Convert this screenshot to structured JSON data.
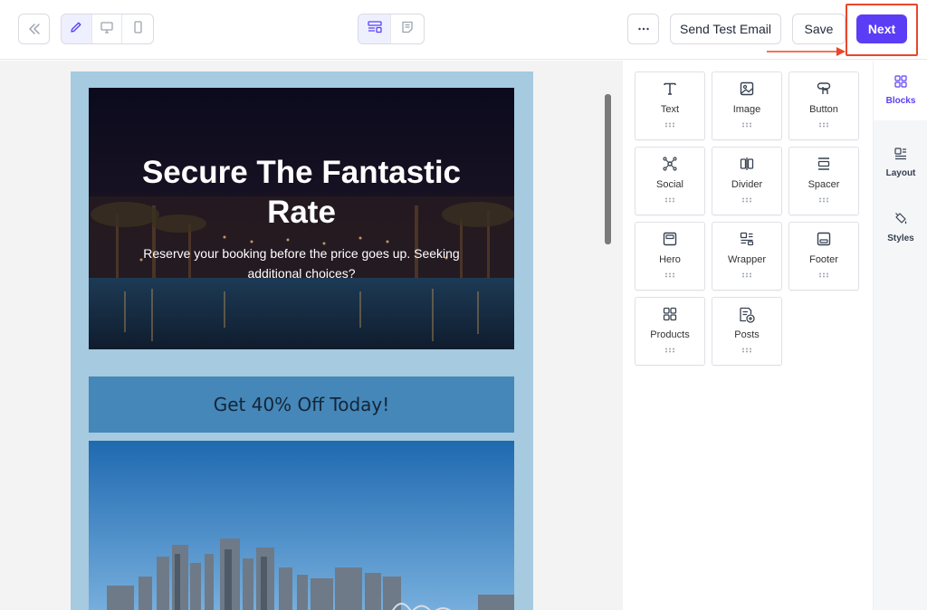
{
  "toolbar": {
    "collapse_icon": "double-chevron-left-icon",
    "view_modes": [
      {
        "icon": "pencil-icon",
        "active": true
      },
      {
        "icon": "desktop-icon",
        "active": false
      },
      {
        "icon": "mobile-icon",
        "active": false
      }
    ],
    "center_modes": [
      {
        "icon": "layout-builder-icon",
        "active": true
      },
      {
        "icon": "notes-icon",
        "active": false
      }
    ],
    "more_icon": "more-horizontal-icon",
    "send_test_label": "Send Test Email",
    "save_label": "Save",
    "next_label": "Next"
  },
  "email": {
    "hero": {
      "title": "Secure The Fantastic Rate",
      "subtitle": "Reserve your booking before the price goes up. Seeking additional choices?"
    },
    "promo": {
      "text": "Get 40% Off Today!"
    }
  },
  "blocks": [
    {
      "label": "Text",
      "icon": "text-icon"
    },
    {
      "label": "Image",
      "icon": "image-icon"
    },
    {
      "label": "Button",
      "icon": "button-icon"
    },
    {
      "label": "Social",
      "icon": "social-icon"
    },
    {
      "label": "Divider",
      "icon": "divider-icon"
    },
    {
      "label": "Spacer",
      "icon": "spacer-icon"
    },
    {
      "label": "Hero",
      "icon": "hero-icon"
    },
    {
      "label": "Wrapper",
      "icon": "wrapper-icon"
    },
    {
      "label": "Footer",
      "icon": "footer-icon"
    },
    {
      "label": "Products",
      "icon": "products-icon"
    },
    {
      "label": "Posts",
      "icon": "posts-icon"
    }
  ],
  "side_tabs": [
    {
      "label": "Blocks",
      "icon": "blocks-grid-icon",
      "active": true
    },
    {
      "label": "Layout",
      "icon": "layout-icon",
      "active": false
    },
    {
      "label": "Styles",
      "icon": "paint-bucket-icon",
      "active": false
    }
  ],
  "colors": {
    "accent": "#5b3df5",
    "highlight": "#e8472a",
    "email_bg": "#a6cadf",
    "promo_bg": "#4587b8"
  }
}
